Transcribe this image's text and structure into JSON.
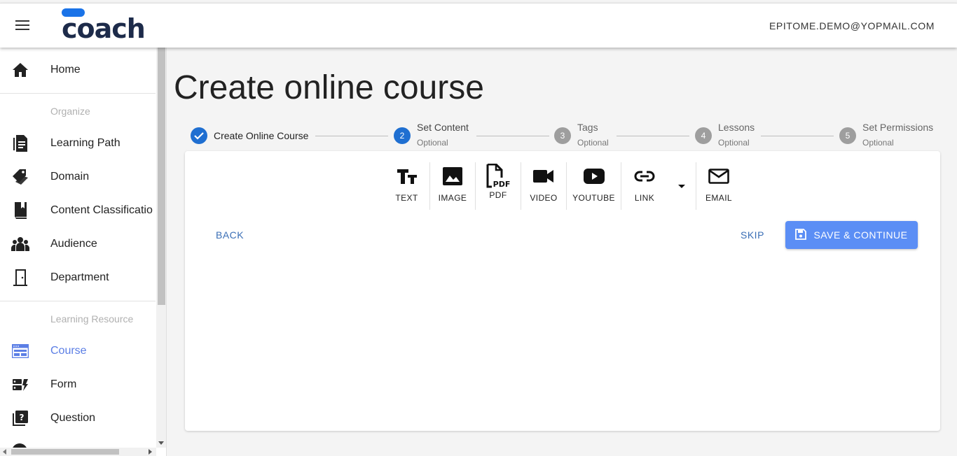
{
  "header": {
    "logo_text": "coach",
    "user_email": "EPITOME.DEMO@YOPMAIL.COM"
  },
  "sidebar": {
    "items": [
      {
        "label": "Home",
        "icon": "home-icon"
      },
      {
        "label": "Learning Path",
        "icon": "document-icon"
      },
      {
        "label": "Domain",
        "icon": "tag-icon"
      },
      {
        "label": "Content Classificatio",
        "icon": "book-icon"
      },
      {
        "label": "Audience",
        "icon": "group-icon"
      },
      {
        "label": "Department",
        "icon": "door-icon"
      },
      {
        "label": "Course",
        "icon": "course-icon"
      },
      {
        "label": "Form",
        "icon": "form-icon"
      },
      {
        "label": "Question",
        "icon": "question-icon"
      }
    ],
    "sections": {
      "organize": "Organize",
      "learning_resource": "Learning Resource"
    },
    "active_item": "Course",
    "active_color": "#5b7ee5"
  },
  "main": {
    "title": "Create online course",
    "steps": [
      {
        "number": "1",
        "title": "Create Online Course",
        "subtitle": "",
        "state": "done"
      },
      {
        "number": "2",
        "title": "Set Content",
        "subtitle": "Optional",
        "state": "current"
      },
      {
        "number": "3",
        "title": "Tags",
        "subtitle": "Optional",
        "state": "pending"
      },
      {
        "number": "4",
        "title": "Lessons",
        "subtitle": "Optional",
        "state": "pending"
      },
      {
        "number": "5",
        "title": "Set Permissions",
        "subtitle": "Optional",
        "state": "pending"
      }
    ],
    "toolbar": {
      "text": "TEXT",
      "image": "IMAGE",
      "pdf": "PDF",
      "video": "VIDEO",
      "youtube": "YOUTUBE",
      "link": "LINK",
      "email": "EMAIL"
    },
    "buttons": {
      "back": "BACK",
      "skip": "SKIP",
      "save": "SAVE & CONTINUE"
    },
    "colors": {
      "primary": "#1f6fd1",
      "save_button": "#5b8ef5",
      "link_text": "#3b6fb6"
    }
  }
}
